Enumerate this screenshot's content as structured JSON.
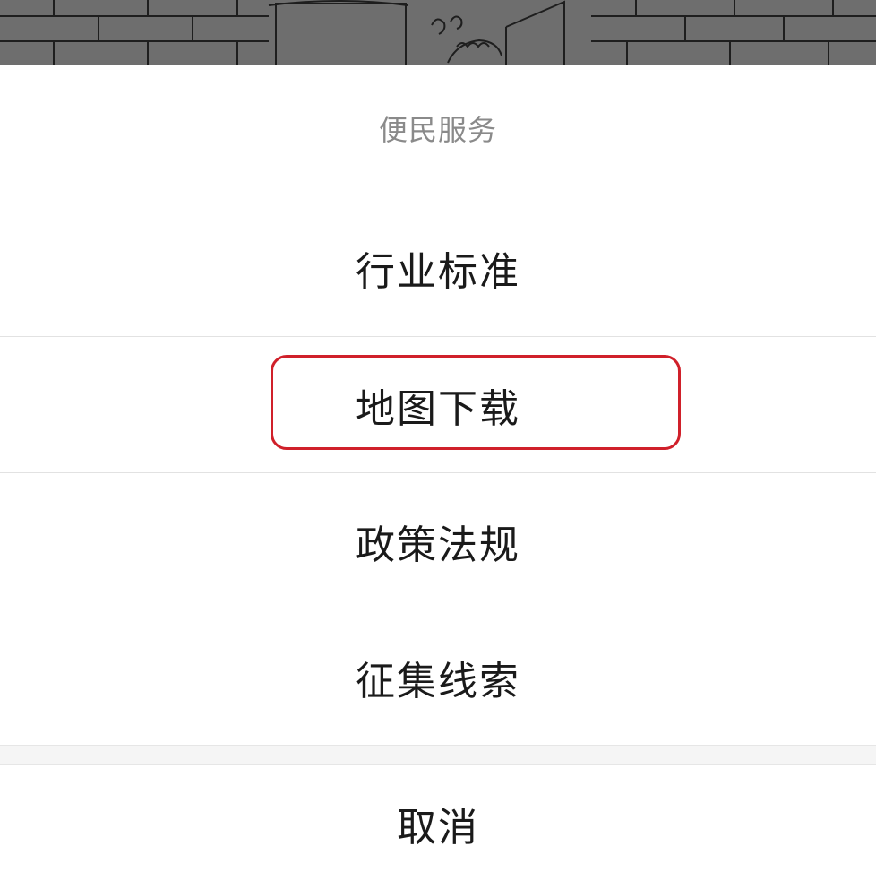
{
  "action_sheet": {
    "title": "便民服务",
    "options": [
      {
        "label": "行业标准"
      },
      {
        "label": "地图下载"
      },
      {
        "label": "政策法规"
      },
      {
        "label": "征集线索"
      }
    ],
    "cancel_label": "取消",
    "highlighted_option": "地图下载"
  },
  "colors": {
    "annotation_red": "#d0202a",
    "title_gray": "#8a8a8a",
    "text_dark": "#1a1a1a",
    "backdrop_dim": "#6e6e6e"
  }
}
